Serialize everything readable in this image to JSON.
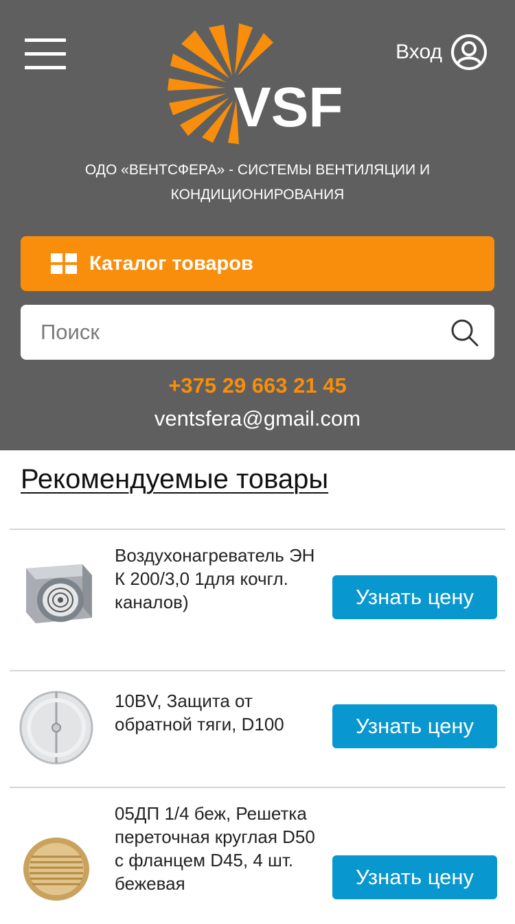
{
  "header": {
    "logo_text": "VSF",
    "login_label": "Вход",
    "tagline": "ОДО «ВЕНТСФЕРА» - СИСТЕМЫ ВЕНТИЛЯЦИИ И КОНДИЦИОНИРОВАНИЯ",
    "catalog_label": "Каталог товаров",
    "search": {
      "placeholder": "Поиск",
      "value": ""
    },
    "phone": "+375 29 663 21 45",
    "email": "ventsfera@gmail.com"
  },
  "main": {
    "section_title": "Рекомендуемые товары",
    "products": [
      {
        "name": "Воздухонагреватель ЭН К 200/3,0 1для кочгл. каналов)",
        "button": "Узнать цену"
      },
      {
        "name": "10BV, Защита от обратной тяги, D100",
        "button": "Узнать цену"
      },
      {
        "name": "05ДП 1/4 беж, Решетка переточная круглая D50 с фланцем D45, 4 шт. бежевая",
        "button": "Узнать цену"
      }
    ]
  },
  "colors": {
    "header_bg": "#5f5f5f",
    "accent_orange": "#f88e0b",
    "button_blue": "#0897cf"
  },
  "icons": [
    "menu-icon",
    "user-icon",
    "grid-icon",
    "search-icon"
  ]
}
